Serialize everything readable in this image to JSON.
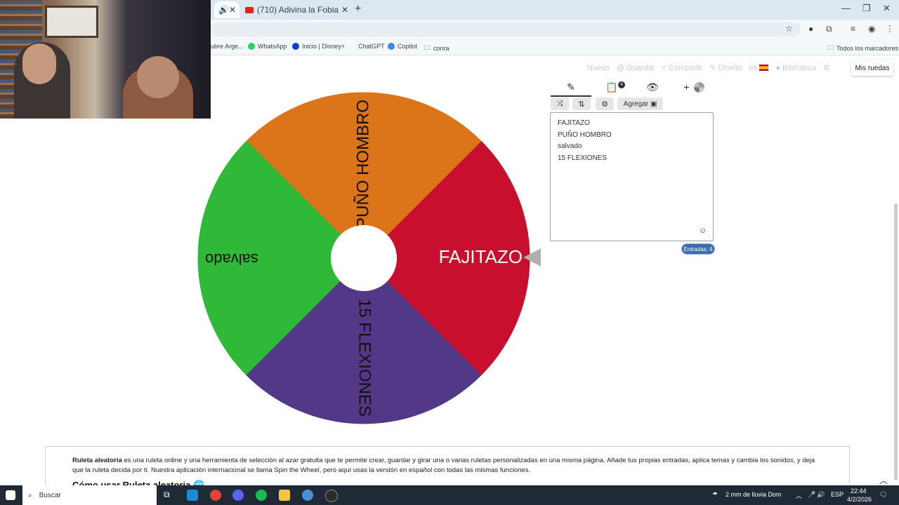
{
  "browser": {
    "tabs": [
      {
        "label": ""
      },
      {
        "label": "(710) Adivina la Fobia 😱🔥💀"
      }
    ],
    "bookmarks": [
      {
        "label": "ubre Arge..."
      },
      {
        "label": "WhatsApp"
      },
      {
        "label": "Inicio | Disney+"
      },
      {
        "label": "ChatGPT"
      },
      {
        "label": "Copilot"
      },
      {
        "label": "conra"
      }
    ],
    "all_bookmarks": "Todos los marcadores"
  },
  "header": {
    "nuevo": "Nuevo",
    "guardar": "Guardar",
    "compartir": "Compartir",
    "diseno": "Diseño",
    "lang": "es",
    "biblioteca": "Biblioteca",
    "mis_ruedas": "Mis ruedas"
  },
  "wheel": {
    "segments": [
      {
        "label": "FAJITAZO",
        "color": "#c8102e"
      },
      {
        "label": "PUÑO HOMBRO",
        "color": "#dc7419"
      },
      {
        "label": "salvado",
        "color": "#30b838"
      },
      {
        "label": "15 FLEXIONES",
        "color": "#523886"
      }
    ],
    "pointer_color": "#b0b0b0"
  },
  "panel": {
    "add_label": "Agregar",
    "badge": "4",
    "entries": [
      "FAJITAZO",
      "PUÑO HOMBRO",
      "salvado",
      "15 FLEXIONES"
    ],
    "count_label": "Entradas: 4"
  },
  "footer": {
    "intro_bold": "Ruleta aleatoria",
    "intro_text": " es una ruleta online y una herramienta de selección al azar gratuita que te permite crear, guardar y girar una o varias ruletas personalizadas en una misma página. Añade tus propias entradas, aplica temas y cambia los sonidos, y deja que la ruleta decida por ti. Nuestra aplicación internacional se llama Spin the Wheel, pero aquí usas la versión en español con todas las mismas funciones.",
    "heading": "Cómo usar Ruleta aleatoria"
  },
  "taskbar": {
    "search": "Buscar",
    "weather": "2 mm de lluvia Dom",
    "lang": "ESP",
    "time": "22:44",
    "date": "4/2/2026"
  }
}
